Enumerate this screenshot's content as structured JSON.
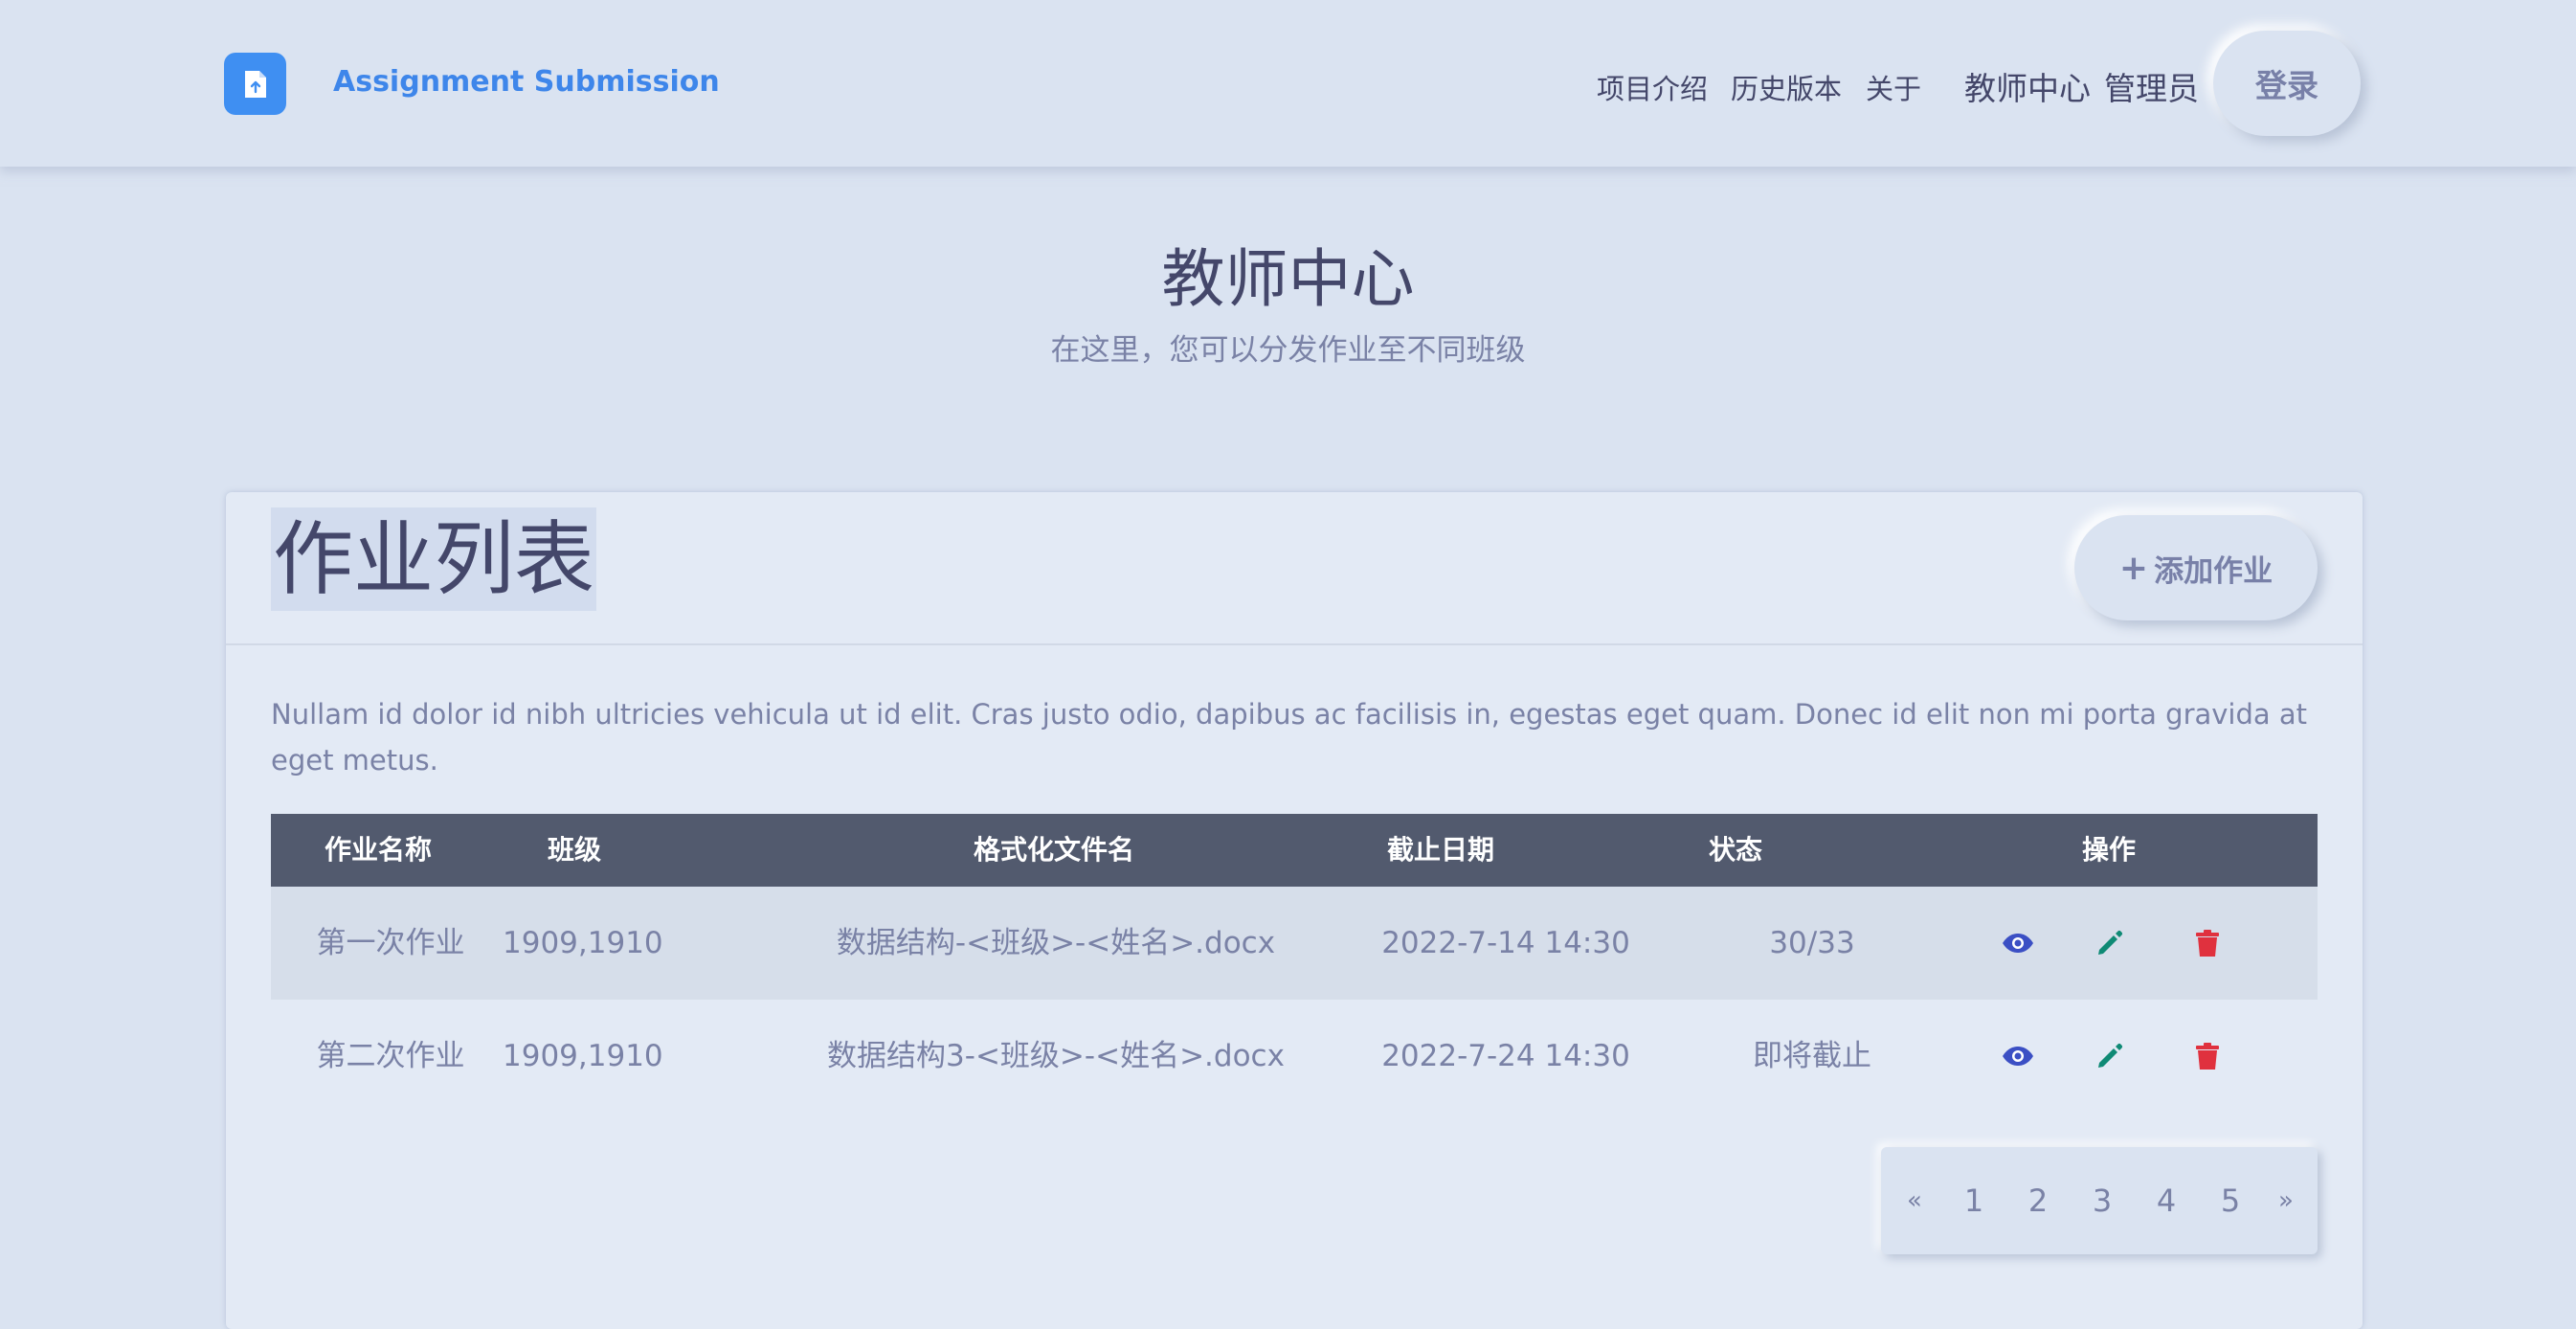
{
  "navbar": {
    "brand": "Assignment Submission",
    "links": [
      "项目介绍",
      "历史版本",
      "关于"
    ],
    "teacher_center": "教师中心",
    "admin": "管理员",
    "login": "登录"
  },
  "header": {
    "title": "教师中心",
    "subtitle": "在这里，您可以分发作业至不同班级"
  },
  "card": {
    "title": "作业列表",
    "add_button": "添加作业",
    "description": "Nullam id dolor id nibh ultricies vehicula ut id elit. Cras justo odio, dapibus ac facilisis in, egestas eget quam. Donec id elit non mi porta gravida at eget metus."
  },
  "table": {
    "headers": [
      "作业名称",
      "班级",
      "格式化文件名",
      "截止日期",
      "状态",
      "操作"
    ],
    "rows": [
      {
        "name": "第一次作业",
        "classes": "1909,1910",
        "filename": "数据结构-<班级>-<姓名>.docx",
        "deadline": "2022-7-14 14:30",
        "status": "30/33"
      },
      {
        "name": "第二次作业",
        "classes": "1909,1910",
        "filename": "数据结构3-<班级>-<姓名>.docx",
        "deadline": "2022-7-24 14:30",
        "status": "即将截止"
      }
    ],
    "action_icons": [
      "eye-icon",
      "pencil-icon",
      "trash-icon"
    ]
  },
  "pagination": {
    "prev": "«",
    "pages": [
      "1",
      "2",
      "3",
      "4",
      "5"
    ],
    "next": "»"
  },
  "colors": {
    "background": "#dae3f1",
    "brand": "#3e86ea",
    "table_header": "#525a6e",
    "view": "#3b4fc4",
    "edit": "#0f8a75",
    "delete": "#e0313e"
  }
}
